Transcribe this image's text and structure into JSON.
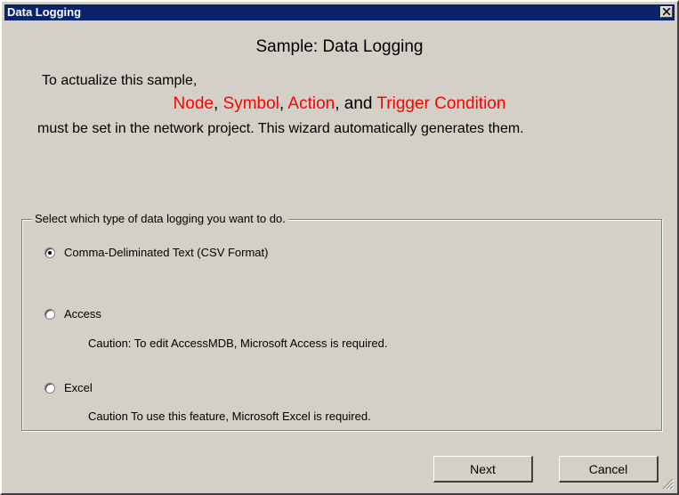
{
  "window": {
    "title": "Data Logging"
  },
  "heading": "Sample: Data Logging",
  "intro": "To actualize this sample,",
  "requirements": {
    "node": "Node",
    "sep1": ", ",
    "symbol": "Symbol",
    "sep2": ", ",
    "action": "Action",
    "sep3": ", and ",
    "trigger": "Trigger Condition"
  },
  "explanation": "must be set in the network project. This wizard automatically generates them.",
  "logging_group": {
    "legend": "Select which type of data logging you want to do.",
    "options": [
      {
        "label": "Comma-Deliminated Text (CSV Format)",
        "checked": true
      },
      {
        "label": "Access",
        "checked": false,
        "caution": "Caution: To edit AccessMDB, Microsoft Access is required."
      },
      {
        "label": "Excel",
        "checked": false,
        "caution": "Caution  To use this feature, Microsoft Excel is required."
      }
    ]
  },
  "buttons": {
    "next": "Next",
    "cancel": "Cancel"
  },
  "colors": {
    "titlebar": "#0a246a",
    "dialog_bg": "#d4d0c8",
    "highlight_text": "#ff0000"
  }
}
